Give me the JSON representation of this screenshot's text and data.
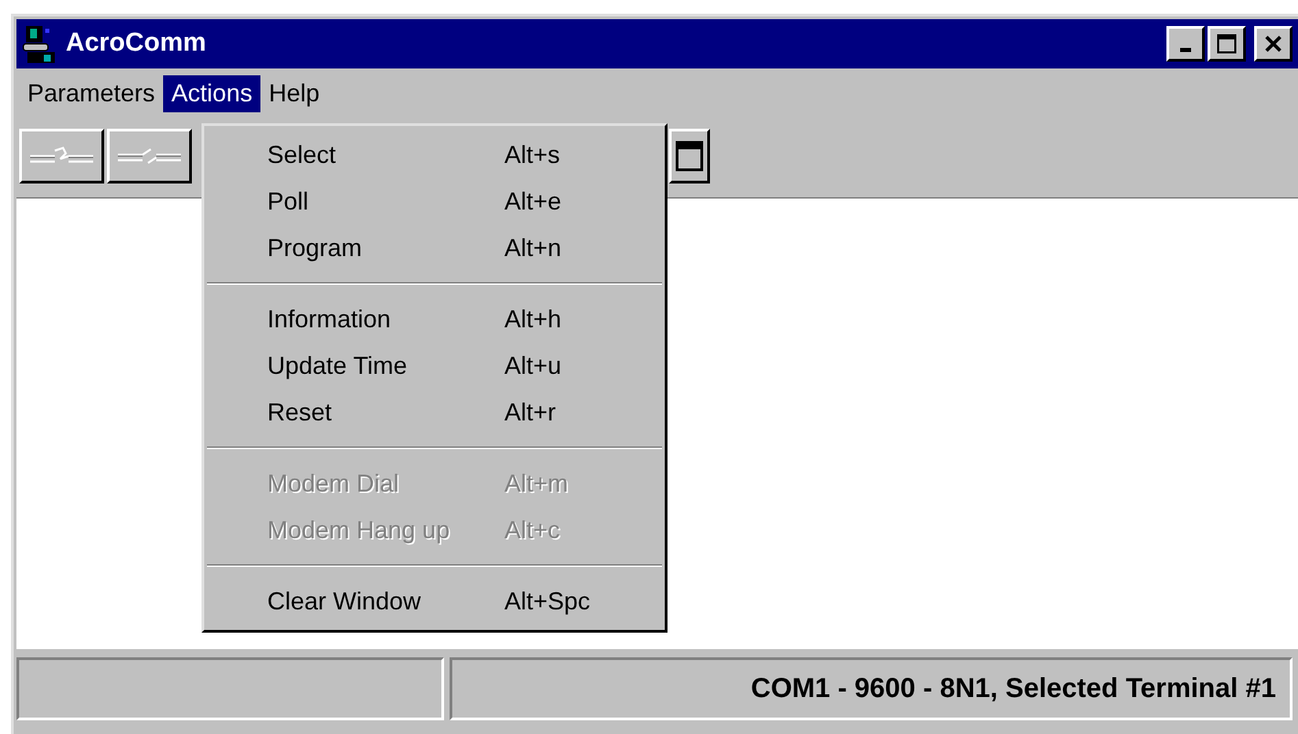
{
  "window": {
    "title": "AcroComm"
  },
  "menu_bar": [
    {
      "label": "Parameters",
      "selected": false
    },
    {
      "label": "Actions",
      "selected": true
    },
    {
      "label": "Help",
      "selected": false
    }
  ],
  "dropdown": [
    {
      "kind": "item",
      "label": "Select",
      "shortcut": "Alt+s",
      "disabled": false
    },
    {
      "kind": "item",
      "label": "Poll",
      "shortcut": "Alt+e",
      "disabled": false
    },
    {
      "kind": "item",
      "label": "Program",
      "shortcut": "Alt+n",
      "disabled": false
    },
    {
      "kind": "separator"
    },
    {
      "kind": "item",
      "label": "Information",
      "shortcut": "Alt+h",
      "disabled": false
    },
    {
      "kind": "item",
      "label": "Update Time",
      "shortcut": "Alt+u",
      "disabled": false
    },
    {
      "kind": "item",
      "label": "Reset",
      "shortcut": "Alt+r",
      "disabled": false
    },
    {
      "kind": "separator"
    },
    {
      "kind": "item",
      "label": "Modem Dial",
      "shortcut": "Alt+m",
      "disabled": true
    },
    {
      "kind": "item",
      "label": "Modem Hang up",
      "shortcut": "Alt+c",
      "disabled": true
    },
    {
      "kind": "separator"
    },
    {
      "kind": "item",
      "label": "Clear Window",
      "shortcut": "Alt+Spc",
      "disabled": false
    }
  ],
  "status_bar": {
    "panel_2": "COM1 - 9600 - 8N1, Selected Terminal #1"
  }
}
